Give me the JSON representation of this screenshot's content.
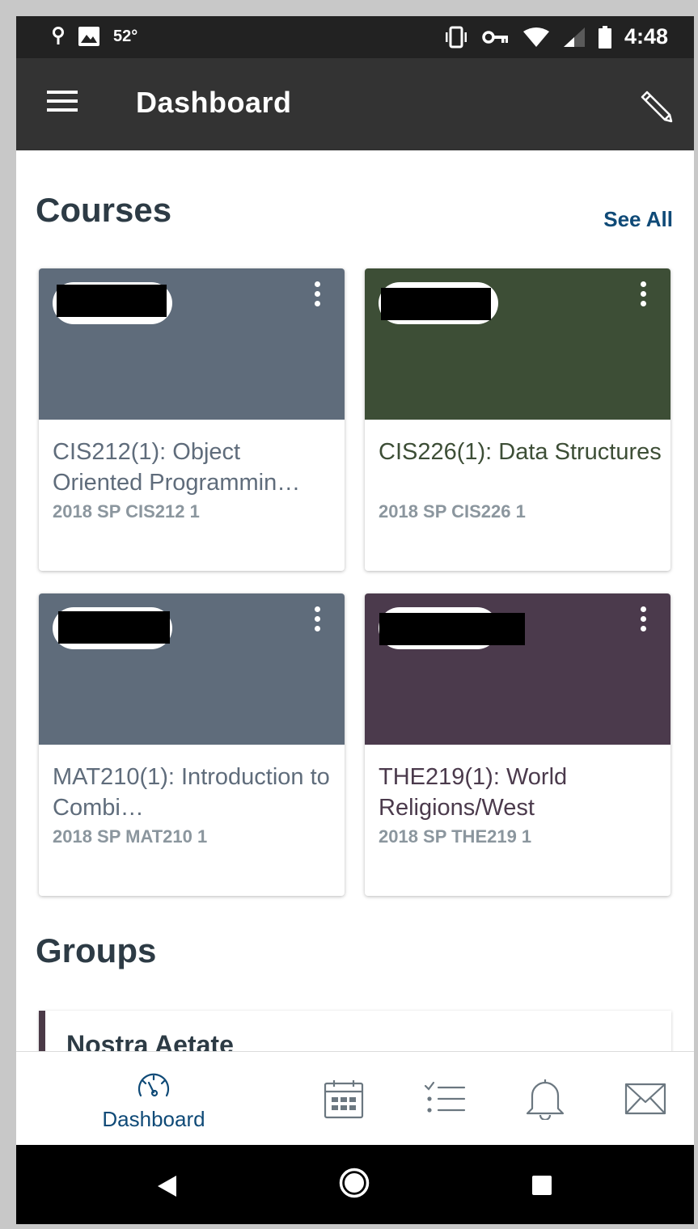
{
  "status_bar": {
    "temperature": "52°",
    "time": "4:48",
    "icons": [
      "location-icon",
      "image-icon",
      "vibrate-icon",
      "vpn-key-icon",
      "wifi-icon",
      "signal-icon",
      "battery-icon"
    ]
  },
  "app_bar": {
    "title": "Dashboard",
    "menu_icon": "hamburger-menu-icon",
    "edit_icon": "pencil-edit-icon"
  },
  "courses": {
    "heading": "Courses",
    "see_all": "See All",
    "items": [
      {
        "name": "CIS212(1): Object Oriented Programmin…",
        "code": "2018 SP CIS212 1",
        "color": "#5f6c7b"
      },
      {
        "name": "CIS226(1): Data Structures",
        "code": "2018 SP CIS226 1",
        "color": "#3d4e36"
      },
      {
        "name": "MAT210(1): Introduction to Combi…",
        "code": "2018 SP MAT210 1",
        "color": "#5f6c7b"
      },
      {
        "name": "THE219(1): World Religions/West",
        "code": "2018 SP THE219 1",
        "color": "#4b3a4c"
      }
    ]
  },
  "groups": {
    "heading": "Groups",
    "items": [
      {
        "name": "Nostra Aetate",
        "color": "#4b3a47"
      }
    ]
  },
  "bottom_nav": {
    "active_label": "Dashboard",
    "items": [
      "dashboard-icon",
      "calendar-icon",
      "todo-list-icon",
      "notifications-bell-icon",
      "inbox-mail-icon"
    ],
    "accent": "#0f4a77"
  },
  "system_nav": {
    "items": [
      "back-icon",
      "home-icon",
      "recents-icon"
    ]
  }
}
